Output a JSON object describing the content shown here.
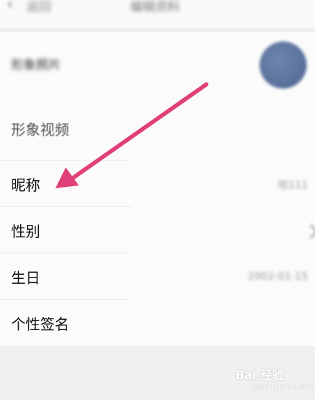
{
  "topbar": {
    "back_icon": "chevron-left-icon",
    "back_label": "返回",
    "title": "编辑资料"
  },
  "profile_photo": {
    "label": "形象照片"
  },
  "rows": [
    {
      "label": "形象视频",
      "value": ""
    },
    {
      "label": "昵称",
      "value": "哈111"
    },
    {
      "label": "性别",
      "value": ""
    },
    {
      "label": "生日",
      "value": "2002-01-15"
    },
    {
      "label": "个性签名",
      "value": ""
    }
  ],
  "annotation": {
    "arrow_color": "#e0407a"
  },
  "watermark": {
    "text": "Bai 经验",
    "sub": "jingyan.baidu.com"
  }
}
